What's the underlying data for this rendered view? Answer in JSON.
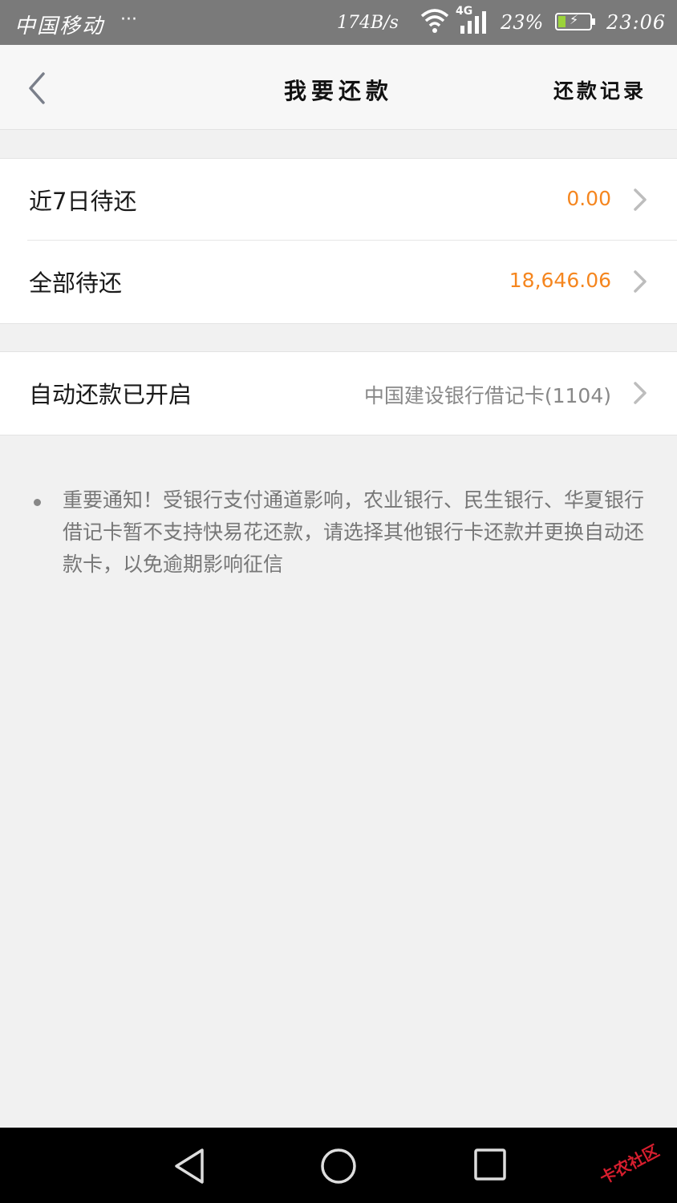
{
  "status_bar": {
    "carrier": "中国移动",
    "more": "···",
    "net_speed": "174B/s",
    "network_type": "4G",
    "battery_percent": "23%",
    "battery_level": 0.23,
    "time": "23:06"
  },
  "nav": {
    "title": "我要还款",
    "right_action": "还款记录"
  },
  "repay_summary": [
    {
      "label": "近7日待还",
      "value": "0.00"
    },
    {
      "label": "全部待还",
      "value": "18,646.06"
    }
  ],
  "auto_repay": {
    "label": "自动还款已开启",
    "card": "中国建设银行借记卡(1104)"
  },
  "notice": {
    "text": "重要通知！受银行支付通道影响，农业银行、民生银行、华夏银行借记卡暂不支持快易花还款，请选择其他银行卡还款并更换自动还款卡，以免逾期影响征信"
  },
  "watermark": "卡农社区",
  "colors": {
    "accent_amount": "#f5861f",
    "status_bar_bg": "#7a7a7a",
    "page_bg": "#f1f1f1",
    "battery_fill": "#9bd33a"
  },
  "icons": {
    "back": "chevron-left-icon",
    "row_arrow": "chevron-right-icon",
    "wifi": "wifi-icon",
    "signal": "signal-icon",
    "battery": "battery-icon",
    "sys_back": "triangle-back-icon",
    "sys_home": "circle-home-icon",
    "sys_recent": "square-recent-icon"
  }
}
